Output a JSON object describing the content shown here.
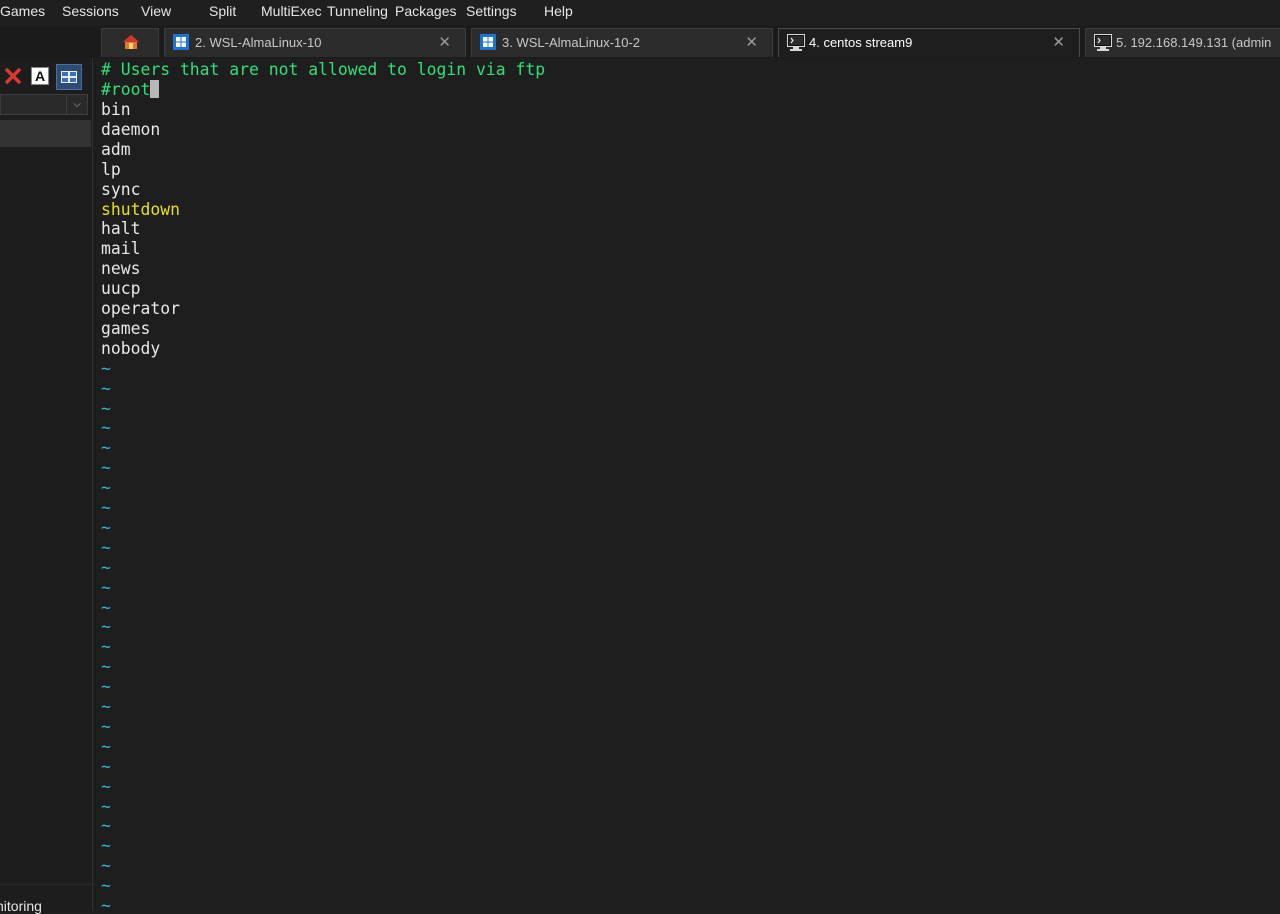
{
  "menu": [
    "Games",
    "Sessions",
    "View",
    "Split",
    "MultiExec",
    "Tunneling",
    "Packages",
    "Settings",
    "Help"
  ],
  "tabs": [
    {
      "label": "",
      "icon": "home-icon",
      "active": false
    },
    {
      "label": "2. WSL-AlmaLinux-10",
      "icon": "windows-icon",
      "active": false
    },
    {
      "label": "3. WSL-AlmaLinux-10-2",
      "icon": "windows-icon",
      "active": false
    },
    {
      "label": "4. centos stream9",
      "icon": "terminal-icon",
      "active": true
    },
    {
      "label": "5. 192.168.149.131 (admin",
      "icon": "terminal-icon",
      "active": false
    }
  ],
  "sidebar": {
    "bottom_label": "nitoring",
    "tools": [
      "close-red-icon",
      "font-a-icon",
      "grid-view-icon"
    ]
  },
  "terminal": {
    "comment": "# Users that are not allowed to login via ftp",
    "cursor_line": "#root",
    "users": [
      "bin",
      "daemon",
      "adm",
      "lp",
      "sync",
      "shutdown",
      "halt",
      "mail",
      "news",
      "uucp",
      "operator",
      "games",
      "nobody"
    ],
    "highlighted_user": "shutdown",
    "tilde": "~",
    "colors": {
      "comment": "#2ee07a",
      "highlight": "#e5e21a",
      "tilde": "#2fb8d8",
      "text": "#e8e8e8"
    }
  }
}
